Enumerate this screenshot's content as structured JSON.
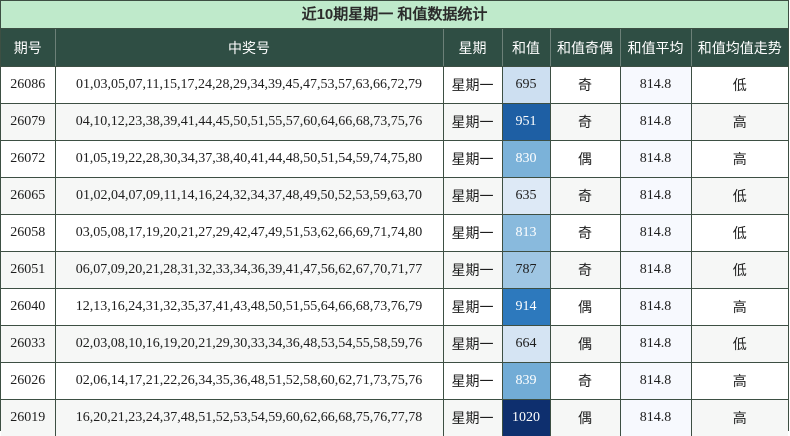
{
  "title": "近10期星期一 和值数据统计",
  "headers": [
    "期号",
    "中奖号",
    "星期",
    "和值",
    "和值奇偶",
    "和值平均",
    "和值均值走势"
  ],
  "colors": {
    "title_bg": "#bfeacb",
    "header_bg": "#2f4e44",
    "sum_scale": [
      "#dde9f6",
      "#0e2f6e"
    ]
  },
  "rows": [
    {
      "issue": "26086",
      "numbers": "01,03,05,07,11,15,17,24,28,29,34,39,45,47,53,57,63,66,72,79",
      "weekday": "星期一",
      "sum": "695",
      "parity": "奇",
      "avg": "814.8",
      "trend": "低"
    },
    {
      "issue": "26079",
      "numbers": "04,10,12,23,38,39,41,44,45,50,51,55,57,60,64,66,68,73,75,76",
      "weekday": "星期一",
      "sum": "951",
      "parity": "奇",
      "avg": "814.8",
      "trend": "高"
    },
    {
      "issue": "26072",
      "numbers": "01,05,19,22,28,30,34,37,38,40,41,44,48,50,51,54,59,74,75,80",
      "weekday": "星期一",
      "sum": "830",
      "parity": "偶",
      "avg": "814.8",
      "trend": "高"
    },
    {
      "issue": "26065",
      "numbers": "01,02,04,07,09,11,14,16,24,32,34,37,48,49,50,52,53,59,63,70",
      "weekday": "星期一",
      "sum": "635",
      "parity": "奇",
      "avg": "814.8",
      "trend": "低"
    },
    {
      "issue": "26058",
      "numbers": "03,05,08,17,19,20,21,27,29,42,47,49,51,53,62,66,69,71,74,80",
      "weekday": "星期一",
      "sum": "813",
      "parity": "奇",
      "avg": "814.8",
      "trend": "低"
    },
    {
      "issue": "26051",
      "numbers": "06,07,09,20,21,28,31,32,33,34,36,39,41,47,56,62,67,70,71,77",
      "weekday": "星期一",
      "sum": "787",
      "parity": "奇",
      "avg": "814.8",
      "trend": "低"
    },
    {
      "issue": "26040",
      "numbers": "12,13,16,24,31,32,35,37,41,43,48,50,51,55,64,66,68,73,76,79",
      "weekday": "星期一",
      "sum": "914",
      "parity": "偶",
      "avg": "814.8",
      "trend": "高"
    },
    {
      "issue": "26033",
      "numbers": "02,03,08,10,16,19,20,21,29,30,33,34,36,48,53,54,55,58,59,76",
      "weekday": "星期一",
      "sum": "664",
      "parity": "偶",
      "avg": "814.8",
      "trend": "低"
    },
    {
      "issue": "26026",
      "numbers": "02,06,14,17,21,22,26,34,35,36,48,51,52,58,60,62,71,73,75,76",
      "weekday": "星期一",
      "sum": "839",
      "parity": "奇",
      "avg": "814.8",
      "trend": "高"
    },
    {
      "issue": "26019",
      "numbers": "16,20,21,23,24,37,48,51,52,53,54,59,60,62,66,68,75,76,77,78",
      "weekday": "星期一",
      "sum": "1020",
      "parity": "偶",
      "avg": "814.8",
      "trend": "高"
    }
  ]
}
